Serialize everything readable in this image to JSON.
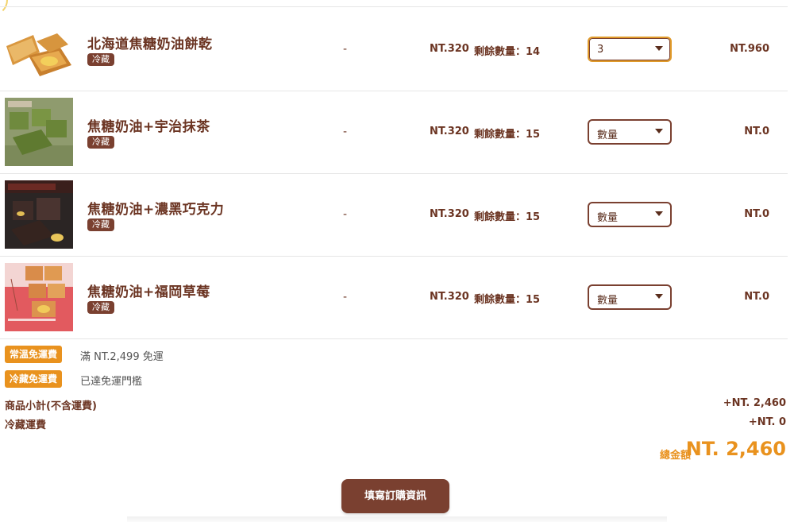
{
  "products": [
    {
      "name": "北海道焦糖奶油餅乾",
      "badge": "冷藏",
      "dash": "-",
      "price": "NT.320",
      "stock": "剩餘數量：14",
      "qty": "3",
      "subtotal": "NT.960",
      "image_icon": "caramel-cookie-photo"
    },
    {
      "name": "焦糖奶油+宇治抹茶",
      "badge": "冷藏",
      "dash": "-",
      "price": "NT.320",
      "stock": "剩餘數量：15",
      "qty": "數量",
      "subtotal": "NT.0",
      "image_icon": "matcha-cookie-photo"
    },
    {
      "name": "焦糖奶油+濃黑巧克力",
      "badge": "冷藏",
      "dash": "-",
      "price": "NT.320",
      "stock": "剩餘數量：15",
      "qty": "數量",
      "subtotal": "NT.0",
      "image_icon": "chocolate-cookie-photo"
    },
    {
      "name": "焦糖奶油+福岡草莓",
      "badge": "冷藏",
      "dash": "-",
      "price": "NT.320",
      "stock": "剩餘數量：15",
      "qty": "數量",
      "subtotal": "NT.0",
      "image_icon": "strawberry-cookie-photo"
    }
  ],
  "shipping": [
    {
      "tag": "常溫免運費",
      "note": "滿 NT.2,499 免運"
    },
    {
      "tag": "冷藏免運費",
      "note": "已達免運門檻"
    }
  ],
  "summary": {
    "subtotal_label": "商品小計(不含運費)",
    "subtotal_value": "+NT. 2,460",
    "cold_ship_label": "冷藏運費",
    "cold_ship_value": "+NT. 0",
    "total_label": "總金額",
    "total_value": "NT. 2,460"
  },
  "submit_label": "填寫訂購資訊",
  "colors": {
    "brown": "#7a4030",
    "orange": "#e9921e",
    "text": "#6b3422"
  }
}
